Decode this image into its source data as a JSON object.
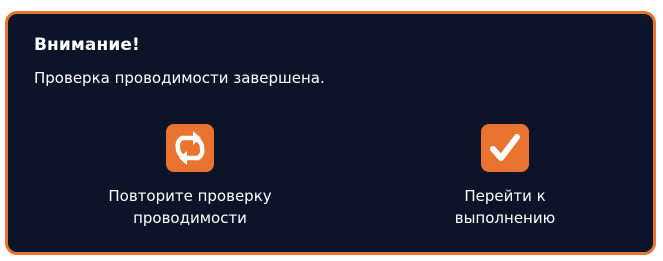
{
  "dialog": {
    "title": "Внимание!",
    "message": "Проверка проводимости завершена.",
    "colors": {
      "background": "#0b1428",
      "border": "#e8742f",
      "accent": "#e8742f",
      "text": "#ffffff"
    }
  },
  "actions": {
    "retry": {
      "icon": "refresh-icon",
      "label": "Повторите проверку\nпроводимости"
    },
    "proceed": {
      "icon": "checkmark-icon",
      "label": "Перейти к\nвыполнению"
    }
  }
}
